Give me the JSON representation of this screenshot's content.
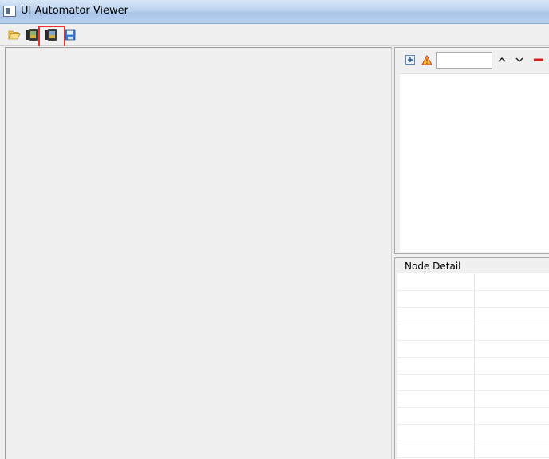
{
  "window": {
    "title": "UI Automator Viewer"
  },
  "toolbar": {
    "buttons": [
      {
        "name": "open",
        "icon": "folder-open-icon"
      },
      {
        "name": "device-screenshot",
        "icon": "device-screenshot-icon"
      },
      {
        "name": "device-screenshot-compressed",
        "icon": "device-screenshot-compressed-icon",
        "highlighted": true
      },
      {
        "name": "save",
        "icon": "save-icon"
      }
    ],
    "highlight_color": "#e8332c"
  },
  "tree_toolbar": {
    "buttons": [
      {
        "name": "expand-all",
        "icon": "expand-all-icon"
      },
      {
        "name": "toggle-nafs",
        "icon": "warning-icon"
      },
      {
        "name": "previous",
        "icon": "chevron-up-icon"
      },
      {
        "name": "next",
        "icon": "chevron-down-icon"
      },
      {
        "name": "clear",
        "icon": "minus-icon"
      }
    ],
    "filter": {
      "value": "",
      "placeholder": ""
    }
  },
  "node_detail": {
    "title": "Node Detail",
    "rows": 11
  }
}
